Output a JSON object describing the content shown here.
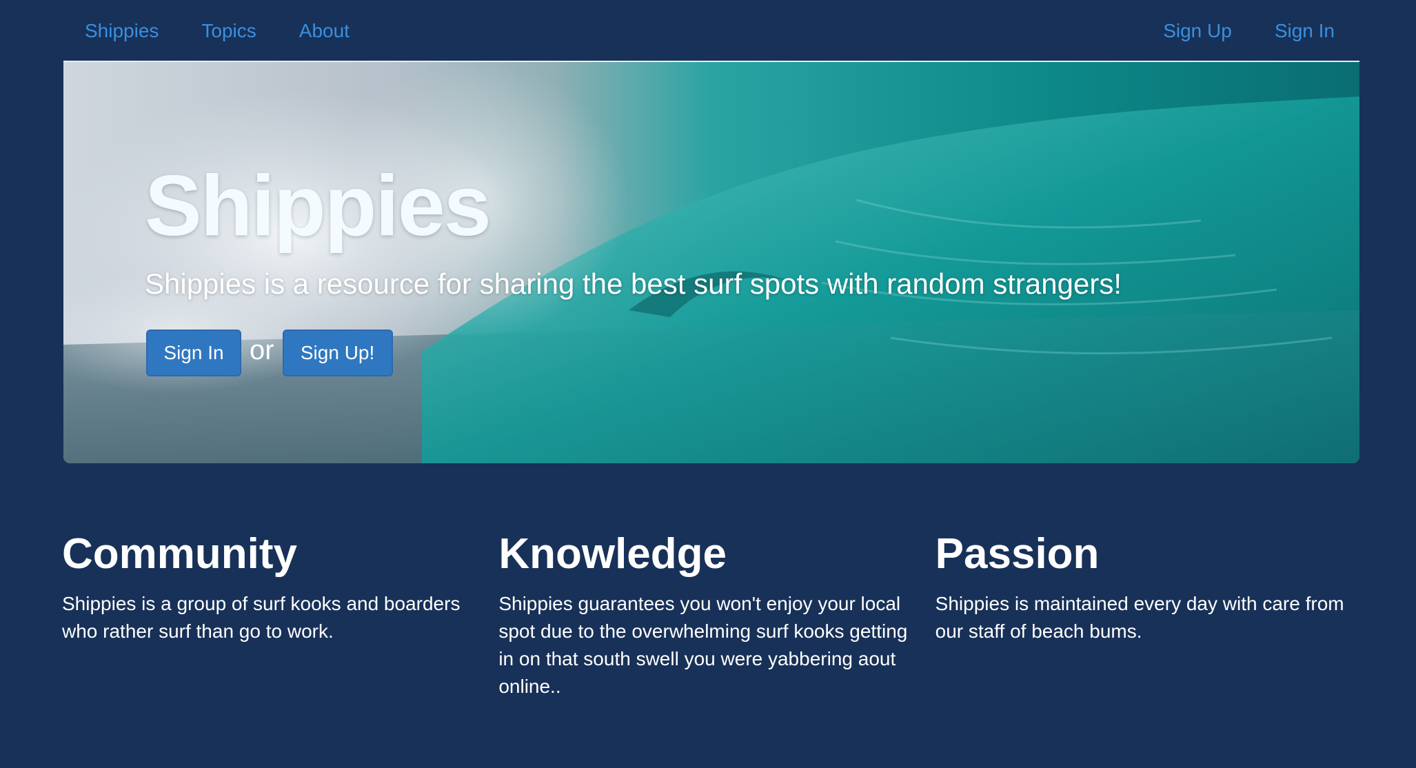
{
  "nav": {
    "brand": "Shippies",
    "topics": "Topics",
    "about": "About",
    "sign_up": "Sign Up",
    "sign_in": "Sign In"
  },
  "hero": {
    "title": "Shippies",
    "tagline": "Shippies is a resource for sharing the best surf spots with random strangers!",
    "sign_in_button": "Sign In",
    "or_text": "or",
    "sign_up_button": "Sign Up!"
  },
  "features": [
    {
      "heading": "Community",
      "text": "Shippies is a group of surf kooks and boarders who rather surf than go to work."
    },
    {
      "heading": "Knowledge",
      "text": "Shippies guarantees you won't enjoy your local spot due to the overwhelming surf kooks getting in on that south swell you were yabbering aout online.."
    },
    {
      "heading": "Passion",
      "text": "Shippies is maintained every day with care from our staff of beach bums."
    }
  ],
  "colors": {
    "background": "#183158",
    "nav_link": "#3a8fe0",
    "button": "#2f78c1",
    "text": "#ffffff"
  }
}
